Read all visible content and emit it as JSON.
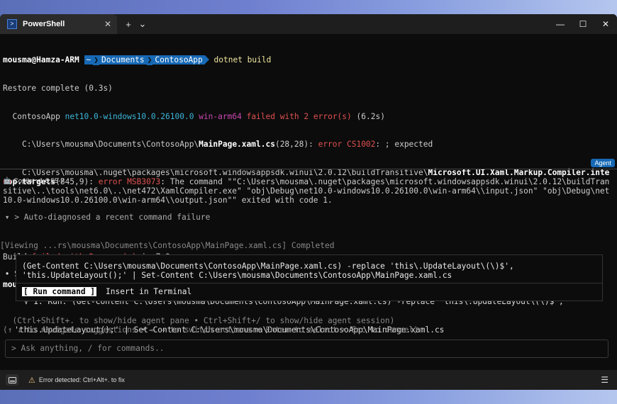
{
  "titlebar": {
    "tab_title": "PowerShell",
    "new_tab": "+",
    "dropdown": "⌄",
    "minimize": "—",
    "maximize": "☐",
    "close": "✕",
    "tab_close": "✕"
  },
  "terminal": {
    "prompt_user": "mousma@Hamza-ARM",
    "prompt_home": "~",
    "prompt_dir1": "Documents",
    "prompt_dir2": "ContosoApp",
    "command": "dotnet build",
    "line_restore": "Restore complete (0.3s)",
    "build_line_project": "  ContosoApp",
    "build_line_target": "net10.0-windows10.0.26100.0",
    "build_line_arch": "win-arm64",
    "build_line_failed": "failed with 2 error(s)",
    "build_line_time": "(6.2s)",
    "err1_path_pre": "    C:\\Users\\mousma\\Documents\\ContosoApp\\",
    "err1_file": "MainPage.xaml.cs",
    "err1_pos": "(28,28): ",
    "err1_code": "error CS1002",
    "err1_msg": ": ; expected",
    "err2_path_pre": "    C:\\Users\\mousma\\.nuget\\packages\\microsoft.windowsappsdk.winui\\2.0.12\\buildTransitive\\",
    "err2_file": "Microsoft.UI.Xaml.Markup.Compiler.interop.targets",
    "err2_pos": "(845,9): ",
    "err2_code": "error MSB3073",
    "err2_msg": ": The command \"\"C:\\Users\\mousma\\.nuget\\packages\\microsoft.windowsappsdk.winui\\2.0.12\\buildTransitive\\..\\tools\\net6.0\\..\\net472\\XamlCompiler.exe\" \"obj\\Debug\\net10.0-windows10.0.26100.0\\win-arm64\\\\input.json\" \"obj\\Debug\\net10.0-windows10.0.26100.0\\win-arm64\\\\output.json\"\" exited with code 1.",
    "summary_pre": "Build ",
    "summary_failed": "failed with 2 error(s)",
    "summary_post": " in 7.0s",
    "agent_badge": "Agent"
  },
  "copilot": {
    "header": "Copilot v1.0.55-7",
    "line1": " ▾ > Auto-diagnosed a recent command failure",
    "line2": "[Viewing ...rs\\mousma\\Documents\\ContosoApp\\MainPage.xaml.cs] Completed",
    "line3": " • Suggested 1 option:",
    "line4": "     √ 1. Run: (Get-Content C:\\Users\\mousma\\Documents\\ContosoApp\\MainPage.xaml.cs) -replace 'this\\.UpdateLayout\\(\\)$',",
    "line5": "   'this.UpdateLayout();' | Set-Content C:\\Users\\mousma\\Documents\\ContosoApp\\MainPage.xaml.cs",
    "cmd_line1": "(Get-Content C:\\Users\\mousma\\Documents\\ContosoApp\\MainPage.xaml.cs) -replace 'this\\.UpdateLayout\\(\\)$',",
    "cmd_line2": "'this.UpdateLayout();' | Set-Content C:\\Users\\mousma\\Documents\\ContosoApp\\MainPage.xaml.cs",
    "run_button": "[ Run command ]",
    "insert_button": "Insert in Terminal",
    "hint1": "  (Ctrl+Shift+. to show/hide agent pane • Ctrl+Shift+/ to show/hide agent session)",
    "hint2": "(↑ ↓ to navigate suggestions • ← → to switch actions • Enter to select • Esc to cancel)",
    "ask_placeholder": "> Ask anything, / for commands.."
  },
  "statusbar": {
    "error_text": "Error detected: Ctrl+Alt+. to fix",
    "warn_icon": "⚠",
    "menu_icon": "☰"
  },
  "colors": {
    "accent": "#1769b5",
    "error": "#e05050",
    "target": "#3bb6d9",
    "arch": "#c847b0"
  }
}
